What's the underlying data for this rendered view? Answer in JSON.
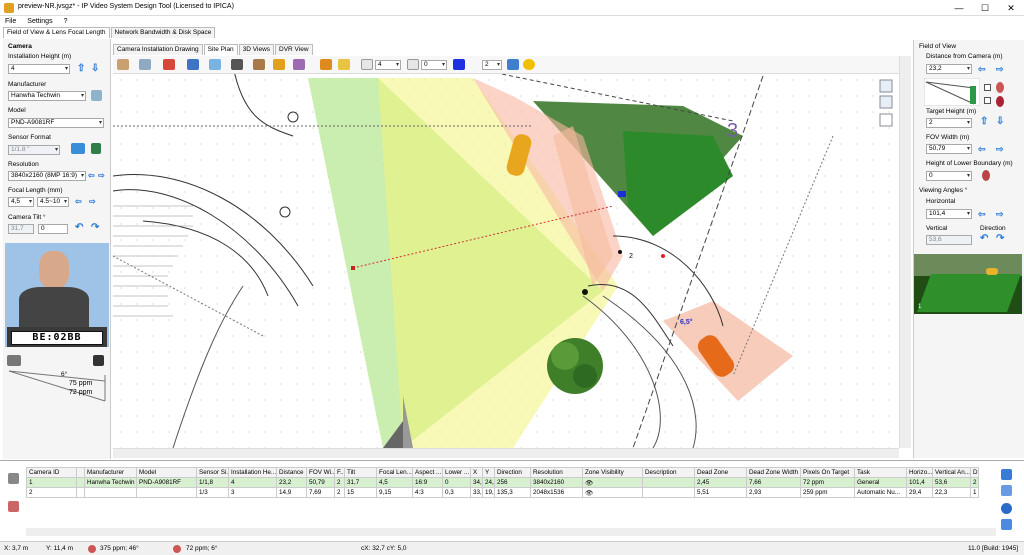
{
  "window": {
    "title": "preview-NR.jvsgz* - IP Video System Design Tool (Licensed to IPICA)",
    "minimize": "—",
    "maximize": "☐",
    "close": "✕"
  },
  "menu": {
    "file": "File",
    "settings": "Settings",
    "help": "?"
  },
  "left_tabs": {
    "fov": "Field of View & Lens Focal Length",
    "bandwidth": "Network Bandwidth & Disk Space"
  },
  "view_tabs": {
    "install": "Camera Installation Drawing",
    "site": "Site Plan",
    "views3d": "3D Views",
    "dvr": "DVR View"
  },
  "camera": {
    "header": "Camera",
    "install_height_label": "Installation Height (m)",
    "install_height": "4",
    "manufacturer_label": "Manufacturer",
    "manufacturer": "Hanwha Techwin",
    "model_label": "Model",
    "model": "PND-A9081RF",
    "sensor_label": "Sensor Format",
    "sensor": "1/1.8 \"",
    "resolution_label": "Resolution",
    "resolution": "3840x2160 (8MP 16:9)",
    "focal_label": "Focal Length (mm)",
    "focal": "4,5",
    "focal_range": "4.5~10",
    "tilt_label": "Camera Tilt °",
    "tilt_auto": "31,7",
    "tilt": "0",
    "plate": "BE:02BB",
    "angle": "6°",
    "ppm1": "75 ppm",
    "ppm2": "72 ppm"
  },
  "toolbar": {
    "layer": "4",
    "thickness": "0",
    "num": "2"
  },
  "canvas": {
    "angle_label": "6,5°",
    "marker_num": "2",
    "big_num": "3"
  },
  "fov_panel": {
    "header": "Field of View",
    "distance_label": "Distance from Camera  (m)",
    "distance": "23,2",
    "target_height_label": "Target Height (m)",
    "target_height": "2",
    "fov_width_label": "FOV Width (m)",
    "fov_width": "50,79",
    "lower_label": "Height of Lower Boundary (m)",
    "lower": "0",
    "angles_header": "Viewing Angles °",
    "horizontal_label": "Horizontal",
    "horizontal": "101,4",
    "vertical_label": "Vertical",
    "vertical": "53,6",
    "direction_label": "Direction",
    "preview_num": "1"
  },
  "table": {
    "headers": [
      "Camera ID",
      "",
      "Manufacturer",
      "Model",
      "Sensor Si...",
      "Installation He...",
      "Distance",
      "FOV Wi...",
      "F...",
      "Tilt",
      "Focal Len...",
      "Aspect ...",
      "Lower ...",
      "X",
      "Y",
      "Direction",
      "Resolution",
      "Zone Visibility",
      "Description",
      "Dead Zone",
      "Dead Zone Width",
      "Pixels On Target",
      "Task",
      "Horizo...",
      "Vertical An...",
      "D"
    ],
    "rows": [
      [
        "1",
        "",
        "Hanwha Techwin",
        "PND-A9081RF",
        "1/1,8",
        "4",
        "23,2",
        "50,79",
        "2",
        "31,7",
        "4,5",
        "16:9",
        "0",
        "34,2",
        "24,2",
        "256",
        "3840x2160",
        "👁",
        "",
        "2,45",
        "7,66",
        "72 ppm",
        "General",
        "101,4",
        "53,6",
        "2"
      ],
      [
        "2",
        "",
        "",
        "",
        "1/3",
        "3",
        "14,9",
        "7,69",
        "2",
        "15",
        "9,15",
        "4:3",
        "0,3",
        "33,8",
        "19,5",
        "135,3",
        "2048x1536",
        "👁",
        "",
        "5,51",
        "2,93",
        "259 ppm",
        "Automatic Nu...",
        "29,4",
        "22,3",
        "1"
      ]
    ]
  },
  "status": {
    "x": "X: 3,7 m",
    "y": "Y: 11,4 m",
    "ppm1": "375 ppm; 46°",
    "ppm2": "72 ppm; 6°",
    "cxy": "cX: 32,7 cY: 5,0",
    "build": "11.0 [Build: 1945]"
  }
}
